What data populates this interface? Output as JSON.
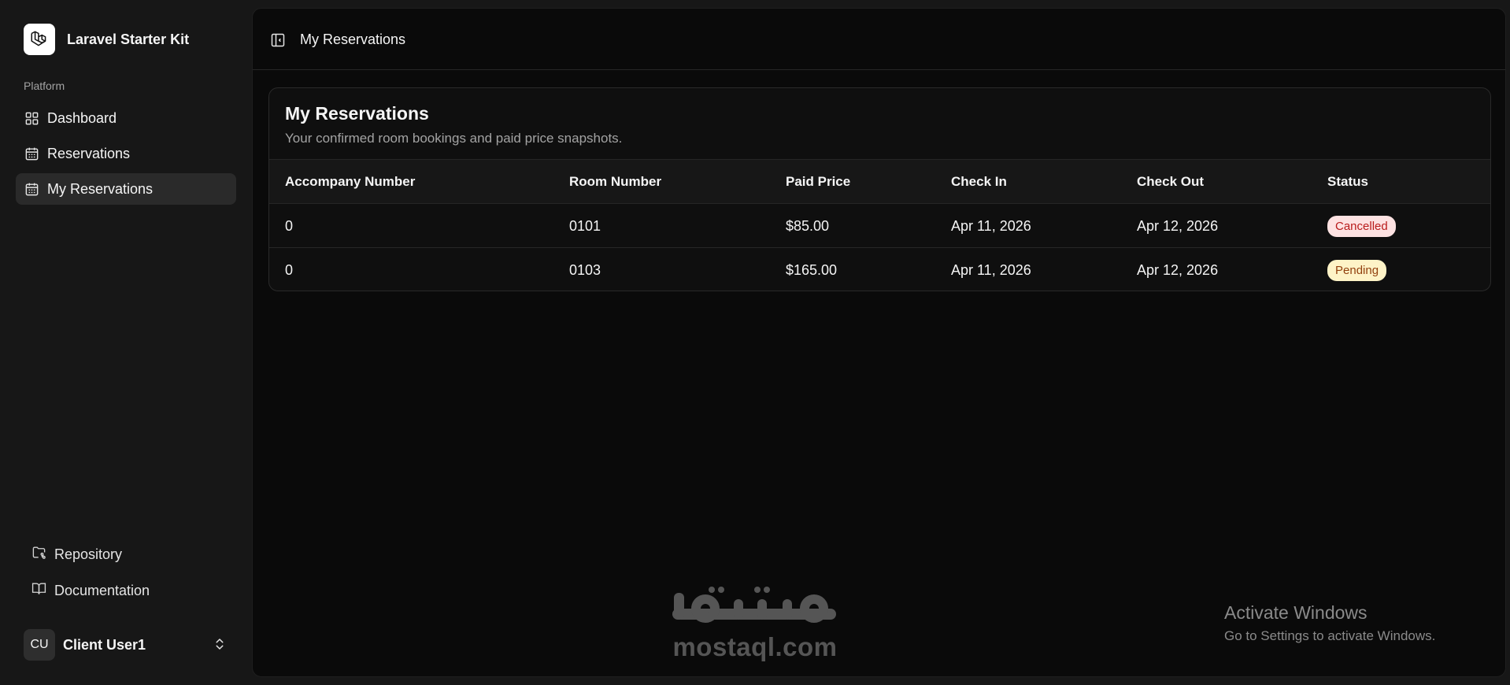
{
  "sidebar": {
    "brand_name": "Laravel Starter Kit",
    "group_label": "Platform",
    "nav": [
      {
        "label": "Dashboard",
        "icon": "layout-grid-icon"
      },
      {
        "label": "Reservations",
        "icon": "calendar-icon"
      },
      {
        "label": "My Reservations",
        "icon": "calendar-icon",
        "active": true
      }
    ],
    "footer_links": [
      {
        "label": "Repository",
        "icon": "folder-git-icon"
      },
      {
        "label": "Documentation",
        "icon": "book-open-icon"
      }
    ],
    "user": {
      "initials": "CU",
      "name": "Client User1"
    }
  },
  "header": {
    "breadcrumb": "My Reservations"
  },
  "card": {
    "title": "My Reservations",
    "subtitle": "Your confirmed room bookings and paid price snapshots.",
    "columns": [
      "Accompany Number",
      "Room Number",
      "Paid Price",
      "Check In",
      "Check Out",
      "Status"
    ],
    "rows": [
      {
        "accompany": "0",
        "room": "0101",
        "price": "$85.00",
        "check_in": "Apr 11, 2026",
        "check_out": "Apr 12, 2026",
        "status": "Cancelled"
      },
      {
        "accompany": "0",
        "room": "0103",
        "price": "$165.00",
        "check_in": "Apr 11, 2026",
        "check_out": "Apr 12, 2026",
        "status": "Pending"
      }
    ]
  },
  "status_colors": {
    "Cancelled": {
      "bg": "#fde2e2",
      "fg": "#b91c1c"
    },
    "Pending": {
      "bg": "#fef3c7",
      "fg": "#92400e"
    }
  },
  "watermark": {
    "text": "mostaql.com"
  },
  "os_notice": {
    "title": "Activate Windows",
    "subtitle": "Go to Settings to activate Windows."
  }
}
